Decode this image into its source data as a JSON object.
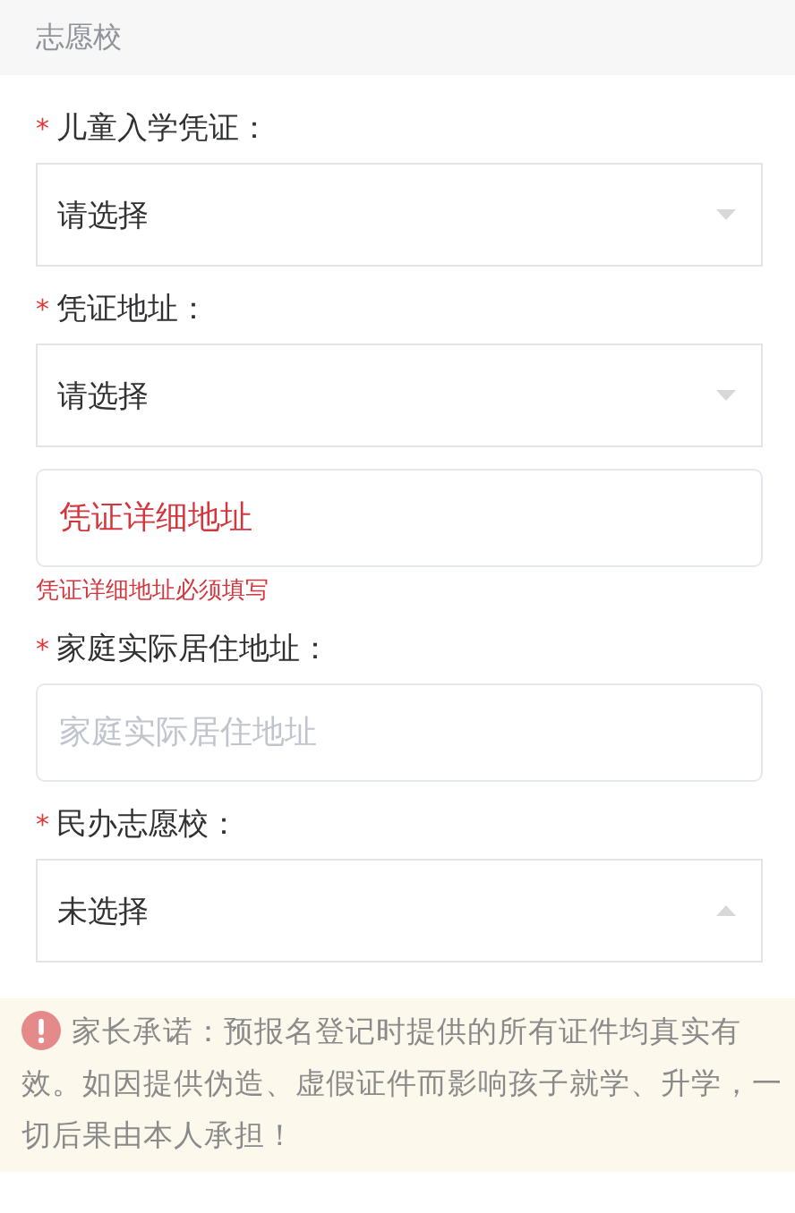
{
  "section": {
    "title": "志愿校"
  },
  "fields": [
    {
      "kind": "select",
      "mark": "*",
      "label": "儿童入学凭证：",
      "value": "请选择",
      "expanded": false
    },
    {
      "kind": "select",
      "mark": "*",
      "label": "凭证地址：",
      "value": "请选择",
      "expanded": false
    },
    {
      "kind": "input",
      "placeholder": "凭证详细地址",
      "invalid": true,
      "error": "凭证详细地址必须填写"
    },
    {
      "kind": "input",
      "mark": "*",
      "label": "家庭实际居住地址：",
      "placeholder": "家庭实际居住地址",
      "invalid": false
    },
    {
      "kind": "select",
      "mark": "*",
      "label": "民办志愿校：",
      "value": "未选择",
      "expanded": true
    }
  ],
  "notice": {
    "text": "家长承诺：预报名登记时提供的所有证件均真实有效。如因提供伪造、虚假证件而影响孩子就学、升学，一切后果由本人承担！"
  }
}
